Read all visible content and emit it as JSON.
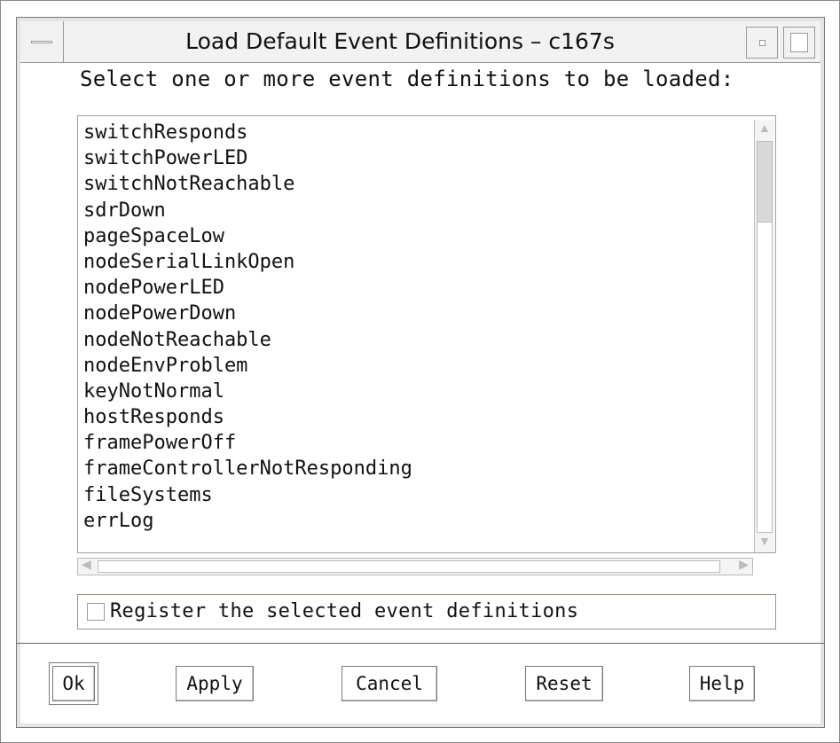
{
  "window": {
    "title": "Load Default Event Definitions – c167s"
  },
  "prompt": "Select one or more event definitions to be loaded:",
  "event_definitions": [
    "switchResponds",
    "switchPowerLED",
    "switchNotReachable",
    "sdrDown",
    "pageSpaceLow",
    "nodeSerialLinkOpen",
    "nodePowerLED",
    "nodePowerDown",
    "nodeNotReachable",
    "nodeEnvProblem",
    "keyNotNormal",
    "hostResponds",
    "framePowerOff",
    "frameControllerNotResponding",
    "fileSystems",
    "errLog"
  ],
  "register_checkbox": {
    "label": "Register the selected event definitions",
    "checked": false
  },
  "buttons": {
    "ok": "Ok",
    "apply": "Apply",
    "cancel": "Cancel",
    "reset": "Reset",
    "help": "Help"
  },
  "icons": {
    "window_menu": "window-menu-icon",
    "minimize": "minimize-icon",
    "maximize": "maximize-icon",
    "scroll_up": "up-arrow-icon",
    "scroll_down": "down-arrow-icon",
    "scroll_left": "left-arrow-icon",
    "scroll_right": "right-arrow-icon"
  },
  "colors": {
    "title_bar": "#f2f2f2",
    "checkbox_frame": "#a98f87"
  }
}
